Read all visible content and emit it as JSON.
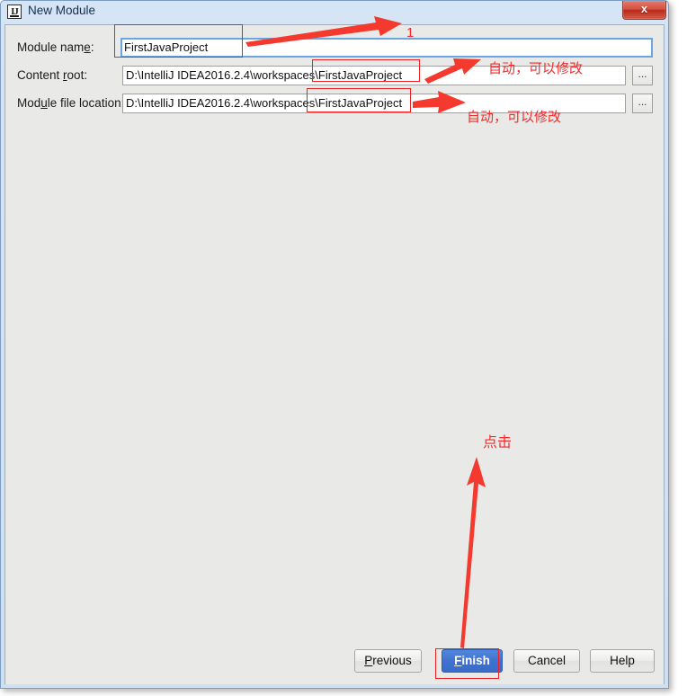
{
  "window": {
    "title": "New Module",
    "icon_name": "intellij-idea-icon",
    "icon_text": "IJ",
    "close_label": "x"
  },
  "form": {
    "fields": [
      {
        "label_prefix": "Module nam",
        "label_mnemonic": "e",
        "label_suffix": ":",
        "value": "FirstJavaProject",
        "placeholder": "",
        "has_browse": false,
        "browse_label": ""
      },
      {
        "label_prefix": "Content ",
        "label_mnemonic": "r",
        "label_suffix": "oot:",
        "value": "D:\\IntelliJ IDEA2016.2.4\\workspaces\\FirstJavaProject",
        "placeholder": "",
        "has_browse": true,
        "browse_label": "..."
      },
      {
        "label_prefix": "Mod",
        "label_mnemonic": "u",
        "label_suffix": "le file location:",
        "value": "D:\\IntelliJ IDEA2016.2.4\\workspaces\\FirstJavaProject",
        "placeholder": "",
        "has_browse": true,
        "browse_label": "..."
      }
    ]
  },
  "buttons": {
    "previous": {
      "prefix": "",
      "mnemonic": "P",
      "suffix": "revious"
    },
    "finish": {
      "prefix": "",
      "mnemonic": "F",
      "suffix": "inish"
    },
    "cancel": {
      "prefix": "Cancel",
      "mnemonic": "",
      "suffix": ""
    },
    "help": {
      "prefix": "Help",
      "mnemonic": "",
      "suffix": ""
    }
  },
  "annotations": {
    "color": "#f22a2a",
    "label_1": "1",
    "label_auto_1": "自动，可以修改",
    "label_auto_2": "自动，可以修改",
    "label_click": "点击"
  },
  "colors": {
    "accent_blue": "#3f72d0",
    "annotation_red": "#f22a2a",
    "dialog_bg": "#e9e9e7",
    "titlebar_blue": "#d6e5f5"
  }
}
